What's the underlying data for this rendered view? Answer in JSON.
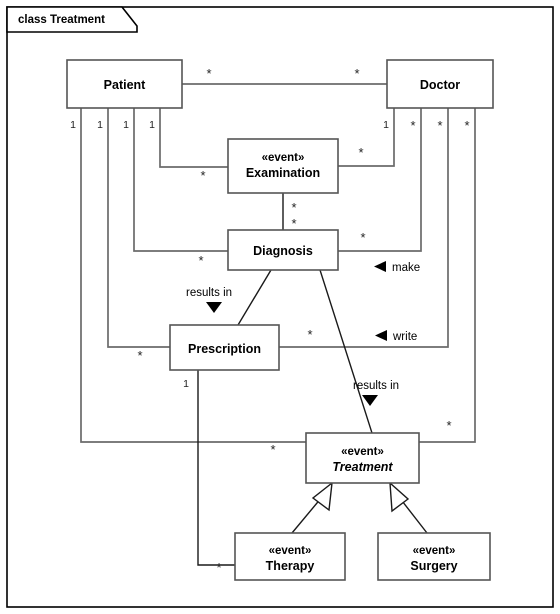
{
  "diagram": {
    "tab_label": "class Treatment",
    "type": "uml-class-diagram",
    "colors": {
      "background": "#ffffff",
      "border": "#000000",
      "box_stroke": "#555555",
      "link_stroke": "#6b6b6b",
      "text": "#000000"
    },
    "classes": [
      {
        "id": "patient",
        "name": "Patient",
        "stereotype": "",
        "abstract": false
      },
      {
        "id": "doctor",
        "name": "Doctor",
        "stereotype": "",
        "abstract": false
      },
      {
        "id": "examination",
        "name": "Examination",
        "stereotype": "«event»",
        "abstract": false
      },
      {
        "id": "diagnosis",
        "name": "Diagnosis",
        "stereotype": "",
        "abstract": false
      },
      {
        "id": "prescription",
        "name": "Prescription",
        "stereotype": "",
        "abstract": false
      },
      {
        "id": "treatment",
        "name": "Treatment",
        "stereotype": "«event»",
        "abstract": true
      },
      {
        "id": "therapy",
        "name": "Therapy",
        "stereotype": "«event»",
        "abstract": false
      },
      {
        "id": "surgery",
        "name": "Surgery",
        "stereotype": "«event»",
        "abstract": false
      }
    ],
    "multiplicities": {
      "patient_doctor_src": "*",
      "patient_doctor_dst": "*",
      "patient_examination": "1",
      "patient_diagnosis": "1",
      "patient_prescription": "1",
      "patient_treatment": "1",
      "examination_patient_end": "*",
      "examination_doctor_end": "*",
      "examination_diagnosis_top": "*",
      "diagnosis_examination_bottom": "*",
      "diagnosis_patient_end": "*",
      "diagnosis_doctor_end": "*",
      "prescription_patient_end": "*",
      "prescription_doctor_end": "*",
      "prescription_therapy_src": "1",
      "prescription_therapy_dst": "*",
      "treatment_patient_end": "*",
      "treatment_doctor_end": "*",
      "doctor_examination": "1",
      "doctor_diagnosis": "*",
      "doctor_prescription": "*",
      "doctor_treatment": "*"
    },
    "association_labels": [
      {
        "id": "make",
        "text": "make",
        "marker": "left-triangle"
      },
      {
        "id": "write",
        "text": "write",
        "marker": "left-triangle"
      },
      {
        "id": "results-in-presc",
        "text": "results in",
        "marker": "down-triangle"
      },
      {
        "id": "results-in-treat",
        "text": "results in",
        "marker": "down-triangle"
      }
    ],
    "generalizations": [
      {
        "from": "therapy",
        "to": "treatment"
      },
      {
        "from": "surgery",
        "to": "treatment"
      }
    ]
  }
}
